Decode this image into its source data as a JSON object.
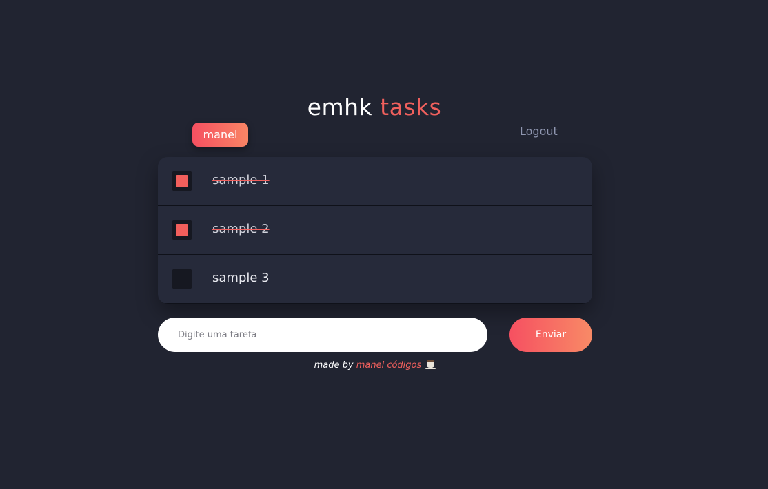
{
  "header": {
    "title_main": "emhk",
    "title_accent": "tasks"
  },
  "user": {
    "name": "manel",
    "logout_label": "Logout"
  },
  "tasks": [
    {
      "label": "sample 1",
      "done": true
    },
    {
      "label": "sample 2",
      "done": true
    },
    {
      "label": "sample 3",
      "done": false
    }
  ],
  "form": {
    "placeholder": "Digite uma tarefa",
    "value": "",
    "submit_label": "Enviar"
  },
  "footer": {
    "prefix": "made by",
    "author": "manel códigos",
    "icon": "coffee-icon"
  },
  "colors": {
    "background": "#212431",
    "accent": "#f0605d",
    "gradient_start": "#f65061",
    "gradient_end": "#f88565",
    "panel": "#262a3a"
  }
}
